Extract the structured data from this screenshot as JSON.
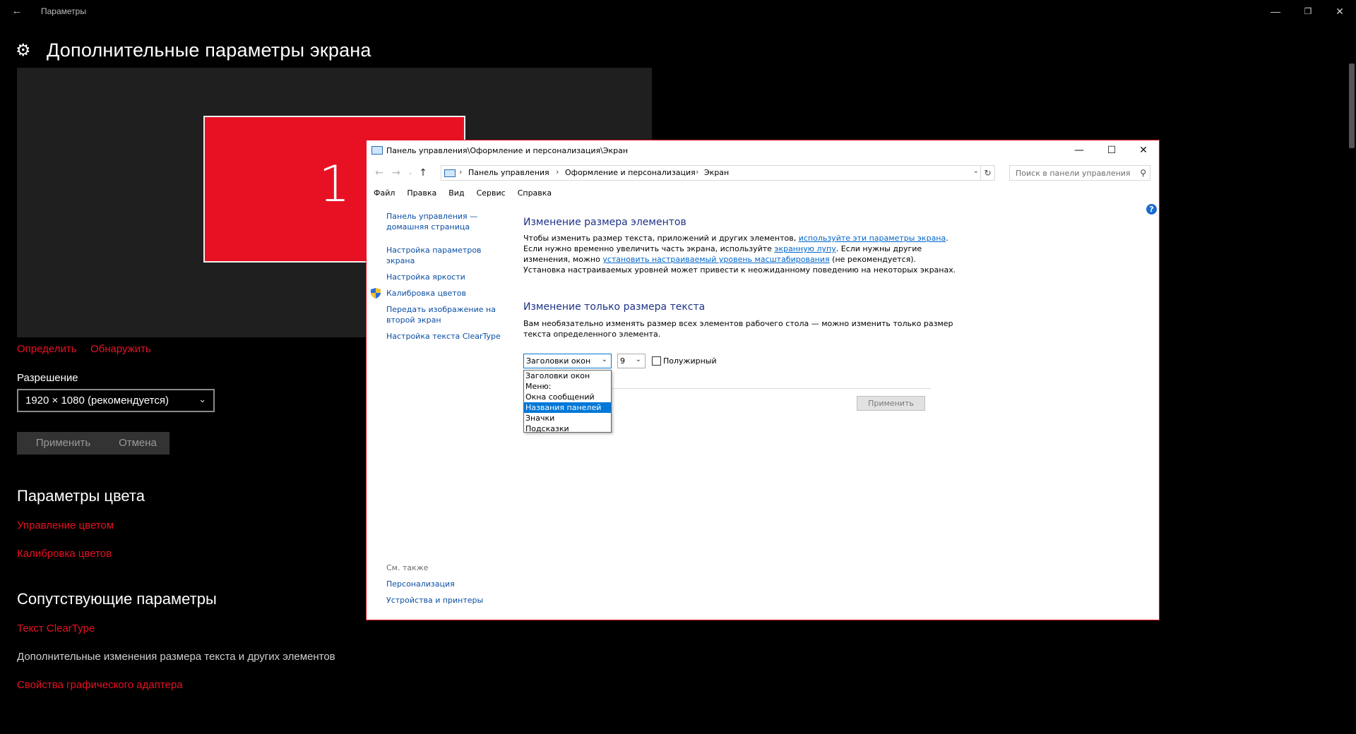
{
  "settings": {
    "window_title": "Параметры",
    "page_title": "Дополнительные параметры экрана",
    "monitor_number": "1",
    "identify": "Определить",
    "detect": "Обнаружить",
    "resolution_label": "Разрешение",
    "resolution_value": "1920 × 1080 (рекомендуется)",
    "apply": "Применить",
    "cancel": "Отмена",
    "color_heading": "Параметры цвета",
    "color_management": "Управление цветом",
    "color_calibration": "Калибровка цветов",
    "related_heading": "Сопутствующие параметры",
    "cleartype": "Текст ClearType",
    "advanced_sizing": "Дополнительные изменения размера текста и других элементов",
    "adapter_props": "Свойства графического адаптера",
    "accent_color": "#e81123"
  },
  "cp": {
    "title": "Панель управления\\Оформление и персонализация\\Экран",
    "breadcrumb": [
      "Панель управления",
      "Оформление и персонализация",
      "Экран"
    ],
    "search_placeholder": "Поиск в панели управления",
    "menu": [
      "Файл",
      "Правка",
      "Вид",
      "Сервис",
      "Справка"
    ],
    "left": {
      "home_1": "Панель управления —",
      "home_2": "домашняя страница",
      "res_1": "Настройка параметров",
      "res_2": "экрана",
      "brightness": "Настройка яркости",
      "calibrate": "Калибровка цветов",
      "project_1": "Передать изображение на",
      "project_2": "второй экран",
      "cleartype": "Настройка текста ClearType",
      "see_also": "См. также",
      "personalization": "Персонализация",
      "devices": "Устройства и принтеры"
    },
    "main": {
      "h1": "Изменение размера элементов",
      "p1_a": "Чтобы изменить размер текста, приложений и других элементов, ",
      "p1_link": "используйте эти параметры экрана",
      "p1_b": ".",
      "p2_a": "Если нужно временно увеличить часть экрана, используйте ",
      "p2_link": "экранную лупу",
      "p2_b": ". Если нужны другие",
      "p3_a": "изменения, можно ",
      "p3_link": "установить настраиваемый уровень масштабирования",
      "p3_b": " (не рекомендуется).",
      "p4": "Установка настраиваемых уровней может привести к неожиданному поведению на некоторых экранах.",
      "h2": "Изменение только размера текста",
      "p5": "Вам необязательно изменять размер всех элементов рабочего стола — можно изменить только размер",
      "p6": "текста определенного элемента.",
      "element_selected": "Заголовки окон",
      "size_selected": "9",
      "bold_label": "Полужирный",
      "options": [
        "Заголовки окон",
        "Меню:",
        "Окна сообщений",
        "Названия панелей",
        "Значки",
        "Подсказки"
      ],
      "highlighted_option": "Названия панелей",
      "apply": "Применить"
    }
  }
}
